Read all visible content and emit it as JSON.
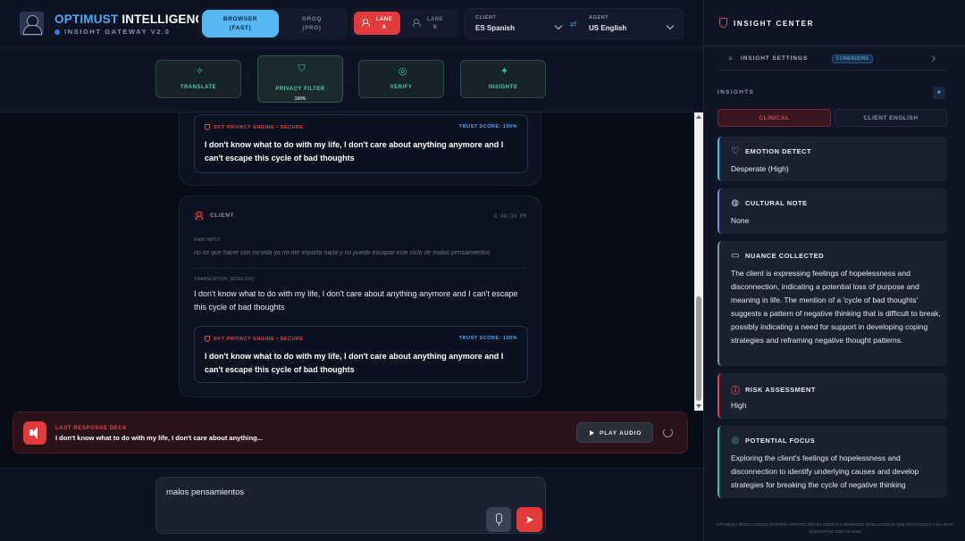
{
  "header": {
    "brand_accent": "OPTIMUST",
    "brand_rest": "INTELLIGENCE",
    "subtitle": "INSIGHT GATEWAY V2.0",
    "engine_modes": [
      {
        "label": "BROWSER",
        "sub": "(FAST)",
        "active": true
      },
      {
        "label": "GROQ",
        "sub": "(PRO)",
        "active": false
      }
    ],
    "lanes": [
      {
        "label": "LANE",
        "sub": "A",
        "active": true
      },
      {
        "label": "LANE",
        "sub": "B",
        "active": false
      }
    ],
    "client_caption": "CLIENT",
    "client_lang": "ES Spanish",
    "agent_caption": "AGENT",
    "agent_lang": "US English"
  },
  "pipeline": [
    {
      "name": "TRANSLATE",
      "icon": "translate-icon"
    },
    {
      "name": "PRIVACY FILTER",
      "pct": "100%",
      "icon": "shield-icon"
    },
    {
      "name": "VERIFY",
      "icon": "fingerprint-icon"
    },
    {
      "name": "INSIGHTS",
      "icon": "sparkle-icon"
    }
  ],
  "chat": {
    "top_secure": {
      "engine": "SKY PRIVACY ENGINE • SECURE",
      "trust": "TRUST SCORE: 100%",
      "text": "I don't know what to do with my life, I don't care about anything anymore and I can't escape this cycle of bad thoughts"
    },
    "message": {
      "who": "CLIENT",
      "time": "6:48:30 PM",
      "raw_caption": "RAW INPUT",
      "raw_text": "no se que hacer con mi vida ya no me importa nada y no puedo escapar este ciclo de malos pensamientos",
      "tr_caption": "TRANSLATION (ENGLISH)",
      "tr_text": "I don't know what to do with my life, I don't care about anything anymore and I can't escape this cycle of bad thoughts",
      "secure": {
        "engine": "SKY PRIVACY ENGINE • SECURE",
        "trust": "TRUST SCORE: 100%",
        "text": "I don't know what to do with my life, I don't care about anything anymore and I can't escape this cycle of bad thoughts"
      }
    }
  },
  "deck": {
    "caption": "LAST RESPONSE DECK",
    "text": "I don't know what to do with my life, I don't care about anything...",
    "play_label": "PLAY AUDIO"
  },
  "composer": {
    "value": "malos pensamientos"
  },
  "panel": {
    "title": "INSIGHT CENTER",
    "settings_label": "INSIGHT SETTINGS",
    "settings_badge": "5 DIMENSIONS",
    "insights_caption": "INSIGHTS",
    "tabs": [
      "CLINICAL",
      "CLIENT ENGLISH"
    ],
    "cards": [
      {
        "title": "EMOTION DETECT",
        "body": "Desperate (High)",
        "accent": "#3fc0e6",
        "icon": "heart-icon"
      },
      {
        "title": "CULTURAL NOTE",
        "body": "None",
        "accent": "#8a7ff0",
        "icon": "globe-icon"
      },
      {
        "title": "NUANCE COLLECTED",
        "body": "The client is expressing feelings of hopelessness and disconnection, indicating a potential loss of purpose and meaning in life. The mention of a 'cycle of bad thoughts' suggests a pattern of negative thinking that is difficult to break, possibly indicating a need for support in developing coping strategies and reframing negative thought patterns.",
        "accent": "#8a95ab",
        "icon": "chat-icon"
      },
      {
        "title": "RISK ASSESSMENT",
        "body": "High",
        "accent": "#e0484b",
        "icon": "alert-icon"
      },
      {
        "title": "POTENTIAL FOCUS",
        "body": "Exploring the client's feelings of hopelessness and disconnection to identify underlying causes and develop strategies for breaking the cycle of negative thinking",
        "accent": "#3fc39a",
        "icon": "target-icon"
      }
    ],
    "footer": "OPTIMUST INTELLIGENCE SYSTEM • PROTECTED BY IDENTITY MINIMIZED INTELLIGENCE (IMI) PROTOCOLS • ALL DATA ENCRYPTED END-TO-END"
  }
}
